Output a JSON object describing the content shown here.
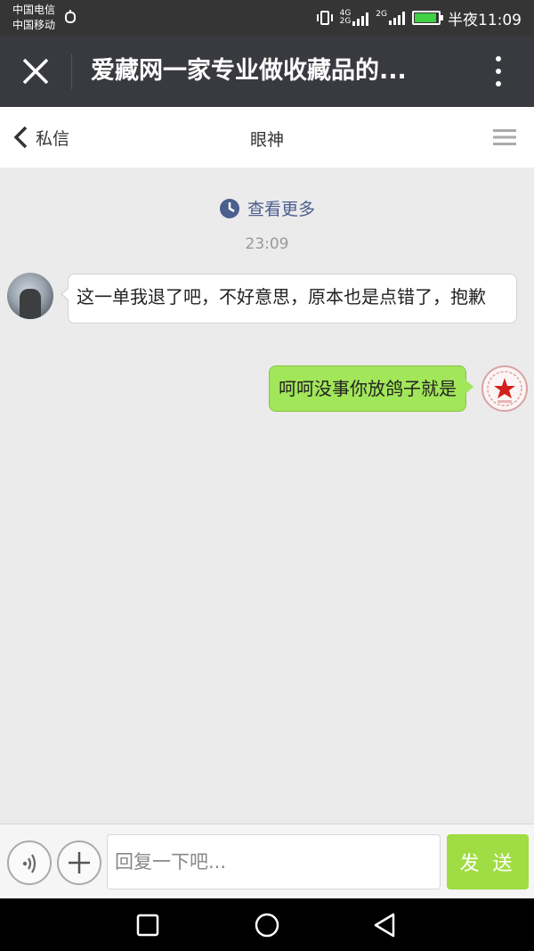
{
  "status_bar": {
    "carrier_1": "中国电信",
    "carrier_2": "中国移动",
    "network_1": "4G",
    "network_2": "2G",
    "network_3": "2G",
    "time": "半夜11:09"
  },
  "title_bar": {
    "title": "爱藏网一家专业做收藏品的..."
  },
  "header": {
    "back_label": "私信",
    "title": "眼神"
  },
  "chat": {
    "load_more_label": "查看更多",
    "timestamp": "23:09",
    "messages": [
      {
        "side": "left",
        "text": "这一单我退了吧，不好意思，原本也是点错了，抱歉"
      },
      {
        "side": "right",
        "text": "呵呵没事你放鸽子就是"
      }
    ]
  },
  "input_bar": {
    "placeholder": "回复一下吧...",
    "send_label": "发 送"
  },
  "colors": {
    "title_bar_bg": "#393a3f",
    "status_bar_bg": "#353535",
    "my_bubble": "#a2e659",
    "send_button": "#a0dc43",
    "link_blue": "#4b5e8e"
  },
  "icons": {
    "close": "close-icon",
    "more": "more-vertical-icon",
    "back": "chevron-left-icon",
    "menu": "hamburger-menu-icon",
    "clock": "clock-icon",
    "voice": "voice-icon",
    "add": "plus-icon"
  }
}
